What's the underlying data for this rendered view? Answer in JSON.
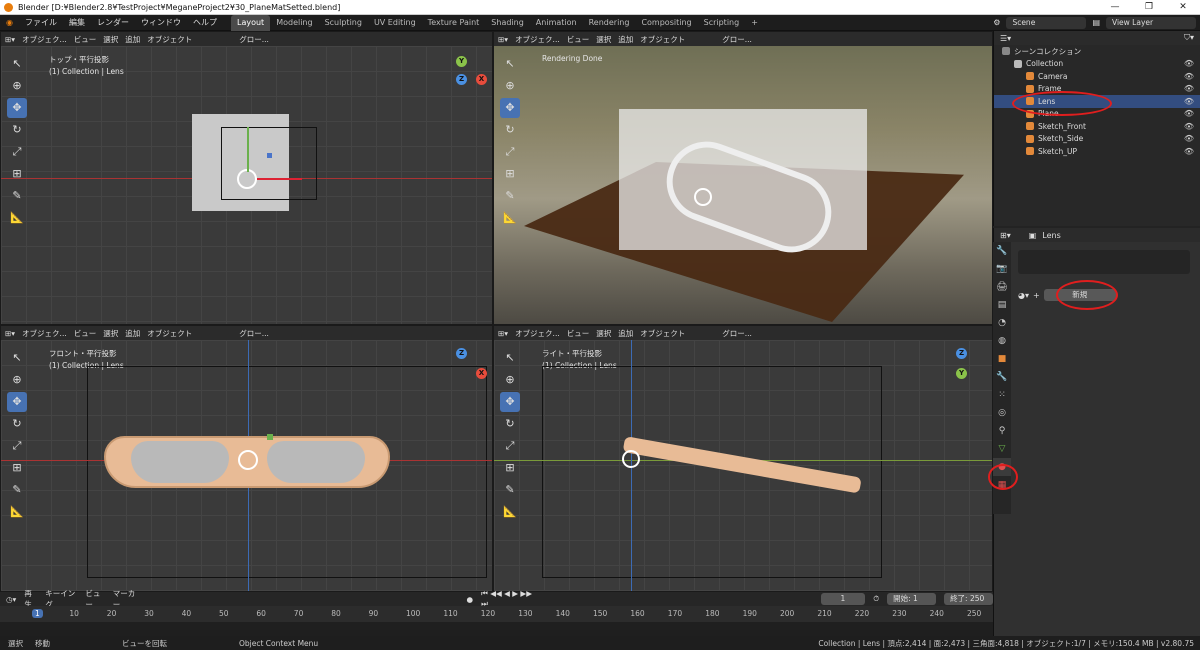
{
  "title": "Blender [D:¥Blender2.8¥TestProject¥MeganeProject2¥30_PlaneMatSetted.blend]",
  "window_controls": [
    "—",
    "❐",
    "✕"
  ],
  "menu": [
    "ファイル",
    "編集",
    "レンダー",
    "ウィンドウ",
    "ヘルプ"
  ],
  "workspaces": [
    "Layout",
    "Modeling",
    "Sculpting",
    "UV Editing",
    "Texture Paint",
    "Shading",
    "Animation",
    "Rendering",
    "Compositing",
    "Scripting",
    "+"
  ],
  "scene": "Scene",
  "view_layer": "View Layer",
  "viewport_header": {
    "mode": "オブジェク...",
    "view": "ビュー",
    "select": "選択",
    "add": "追加",
    "object": "オブジェクト",
    "orient": "グロー..."
  },
  "viewports": [
    {
      "label": "トップ・平行投影",
      "sub": "(1) Collection | Lens"
    },
    {
      "label": "",
      "sub": "Rendering Done"
    },
    {
      "label": "フロント・平行投影",
      "sub": "(1) Collection | Lens"
    },
    {
      "label": "ライト・平行投影",
      "sub": "(1) Collection | Lens"
    }
  ],
  "gizmo_letters": {
    "x": "X",
    "y": "Y",
    "z": "Z"
  },
  "outliner": {
    "root": "シーンコレクション",
    "items": [
      {
        "name": "Collection",
        "color": "#bbbbbb"
      },
      {
        "name": "Camera",
        "color": "#e3893a"
      },
      {
        "name": "Frame",
        "color": "#e3893a"
      },
      {
        "name": "Lens",
        "color": "#e3893a"
      },
      {
        "name": "Plane",
        "color": "#e3893a"
      },
      {
        "name": "Sketch_Front",
        "color": "#e3893a"
      },
      {
        "name": "Sketch_Side",
        "color": "#e3893a"
      },
      {
        "name": "Sketch_UP",
        "color": "#e3893a"
      }
    ]
  },
  "properties": {
    "object": "Lens",
    "new_button": "新規"
  },
  "timeline": {
    "menu": [
      "再生",
      "キーイング",
      "ビュー",
      "マーカー"
    ],
    "current": "1",
    "start_label": "開始:",
    "start": "1",
    "end_label": "終了:",
    "end": "250",
    "ticks": [
      "1",
      "10",
      "20",
      "30",
      "40",
      "50",
      "60",
      "70",
      "80",
      "90",
      "100",
      "110",
      "120",
      "130",
      "140",
      "150",
      "160",
      "170",
      "180",
      "190",
      "200",
      "210",
      "220",
      "230",
      "240",
      "250"
    ]
  },
  "status": {
    "select": "選択",
    "move": "移動",
    "rotate": "ビューを回転",
    "context": "Object Context Menu",
    "stats": "Collection | Lens | 頂点:2,414 | 面:2,473 | 三角面:4,818 | オブジェクト:1/7 | メモリ:150.4 MB | v2.80.75"
  }
}
